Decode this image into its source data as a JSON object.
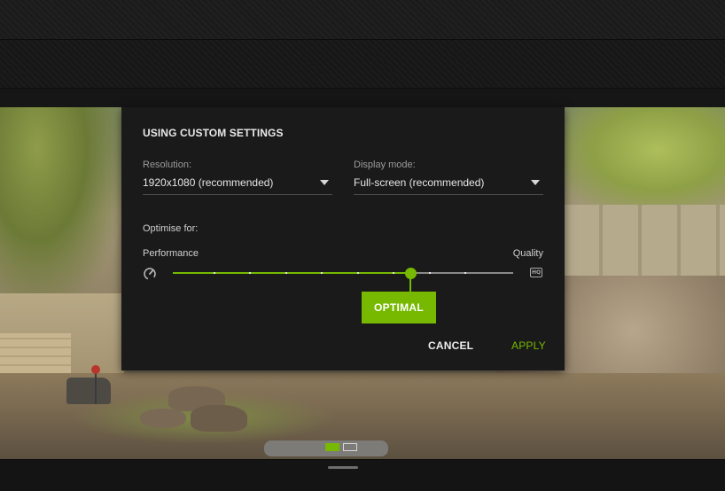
{
  "dialog": {
    "title": "USING CUSTOM SETTINGS",
    "resolution": {
      "label": "Resolution:",
      "value": "1920x1080 (recommended)"
    },
    "display_mode": {
      "label": "Display mode:",
      "value": "Full-screen (recommended)"
    },
    "optimise": {
      "label": "Optimise for:",
      "left_label": "Performance",
      "right_label": "Quality",
      "steps": 10,
      "level": 6,
      "badge": "OPTIMAL",
      "left_icon": "speedometer-icon",
      "right_icon": "hq-icon",
      "right_icon_text": "HQ"
    },
    "buttons": {
      "cancel": "CANCEL",
      "apply": "APPLY"
    }
  },
  "pager": {
    "count": 2,
    "active": 0
  },
  "colors": {
    "accent": "#76b900",
    "panel": "#1a1a1a"
  }
}
